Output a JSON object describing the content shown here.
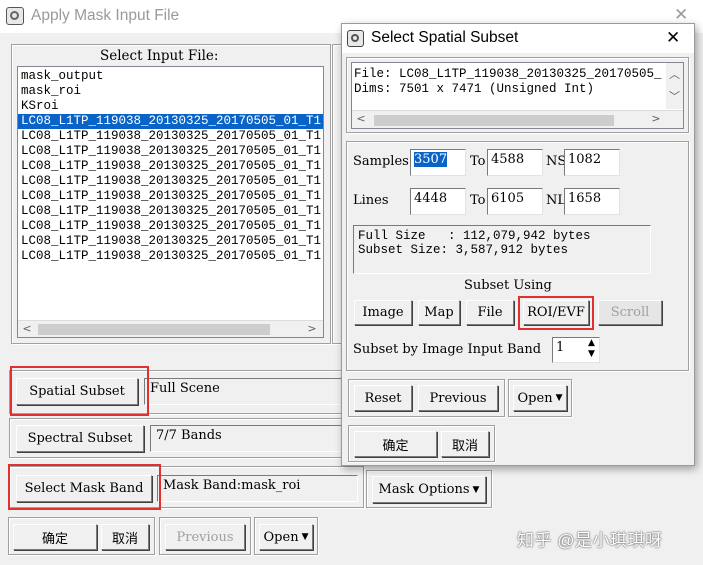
{
  "main_window": {
    "title": "Apply Mask Input File",
    "select_label": "Select Input File:",
    "files": [
      "mask_output",
      "mask_roi",
      "KSroi",
      "LC08_L1TP_119038_20130325_20170505_01_T1",
      "LC08_L1TP_119038_20130325_20170505_01_T1",
      "LC08_L1TP_119038_20130325_20170505_01_T1",
      "LC08_L1TP_119038_20130325_20170505_01_T1",
      "LC08_L1TP_119038_20130325_20170505_01_T1",
      "LC08_L1TP_119038_20130325_20170505_01_T1",
      "LC08_L1TP_119038_20130325_20170505_01_T1",
      "LC08_L1TP_119038_20130325_20170505_01_T1",
      "LC08_L1TP_119038_20130325_20170505_01_T1",
      "LC08_L1TP_119038_20130325_20170505_01_T1"
    ],
    "selected_index": 3,
    "spatial_subset_label": "Spatial Subset",
    "spatial_subset_value": "Full Scene",
    "spectral_subset_label": "Spectral Subset",
    "spectral_subset_value": "7/7 Bands",
    "select_mask_band_label": "Select Mask Band",
    "mask_band_value": "Mask Band:mask_roi",
    "mask_options_label": "Mask Options",
    "ok_label": "确定",
    "cancel_label": "取消",
    "previous_label": "Previous",
    "open_label": "Open"
  },
  "subset_dialog": {
    "title": "Select Spatial Subset",
    "info_file": "File: LC08_L1TP_119038_20130325_20170505_",
    "info_dims": "Dims: 7501 x 7471 (Unsigned Int)",
    "samples_label": "Samples",
    "samples_from": "3507",
    "samples_to_label": "To",
    "samples_to": "4588",
    "ns_label": "NS",
    "ns_value": "1082",
    "lines_label": "Lines",
    "lines_from": "4448",
    "lines_to_label": "To",
    "lines_to": "6105",
    "nl_label": "NL",
    "nl_value": "1658",
    "full_size": "Full Size   : 112,079,942 bytes",
    "subset_size": "Subset Size: 3,587,912 bytes",
    "subset_using_label": "Subset Using",
    "image_label": "Image",
    "map_label": "Map",
    "file_label": "File",
    "roi_evf_label": "ROI/EVF",
    "scroll_label": "Scroll",
    "band_label": "Subset by Image Input Band",
    "band_value": "1",
    "reset_label": "Reset",
    "previous_label": "Previous",
    "open_label": "Open",
    "ok_label": "确定",
    "cancel_label": "取消"
  },
  "watermark": "知乎 @是小琪琪呀",
  "colors": {
    "highlight": "#e03030",
    "selection": "#0a64c8"
  }
}
